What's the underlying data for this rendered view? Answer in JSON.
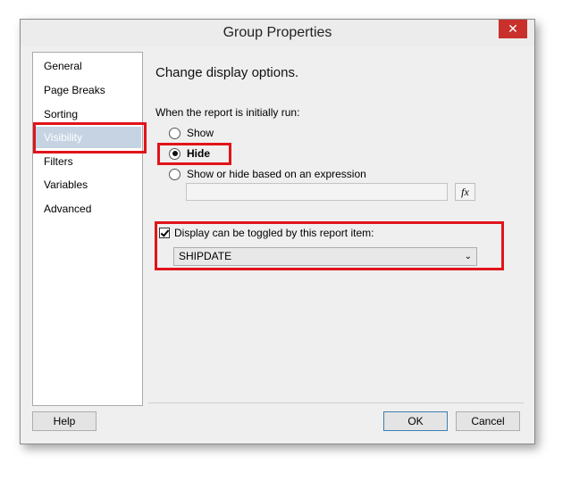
{
  "window": {
    "title": "Group Properties",
    "close_label": "✕"
  },
  "sidebar": {
    "items": [
      {
        "label": "General"
      },
      {
        "label": "Page Breaks"
      },
      {
        "label": "Sorting"
      },
      {
        "label": "Visibility"
      },
      {
        "label": "Filters"
      },
      {
        "label": "Variables"
      },
      {
        "label": "Advanced"
      }
    ],
    "selected": "Visibility"
  },
  "main": {
    "heading": "Change display options.",
    "initial_label": "When the report is initially run:",
    "radios": [
      {
        "label": "Show"
      },
      {
        "label": "Hide"
      },
      {
        "label": "Show or hide based on an expression"
      }
    ],
    "selected_radio": "Hide",
    "expression_value": "",
    "fx_label": "fx",
    "toggle_label": "Display can be toggled by this report item:",
    "toggle_checked": true,
    "toggle_item": "SHIPDATE",
    "dropdown_icon": "⌄"
  },
  "footer": {
    "help": "Help",
    "ok": "OK",
    "cancel": "Cancel"
  },
  "colors": {
    "highlight": "#e0141a",
    "selected": "#c5d3e2",
    "close": "#c9302c"
  }
}
